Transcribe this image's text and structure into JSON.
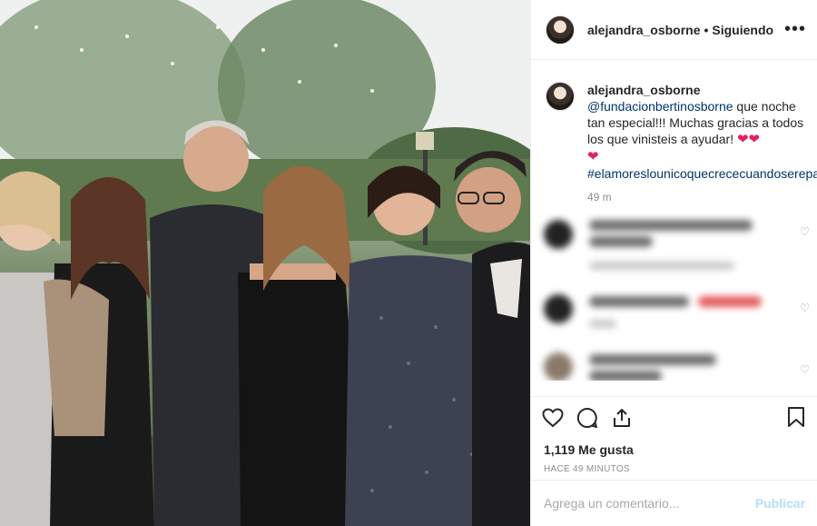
{
  "post": {
    "username": "alejandra_osborne",
    "separator": "•",
    "follow_status": "Siguiendo",
    "more": "•••",
    "caption": {
      "username": "alejandra_osborne",
      "mention": "@fundacionbertinosborne",
      "text_1": " que noche tan especial!!! Muchas gracias a todos los que vinisteis a ayudar! ",
      "hearts_1": "❤❤",
      "hearts_2": "❤",
      "hashtag": "#elamoreslounicoquecrececuandosereparte"
    },
    "caption_time": "49 m",
    "likes": "1,119 Me gusta",
    "posted_ago": "HACE 49 MINUTOS",
    "comment_placeholder": "Agrega un comentario...",
    "publish_label": "Publicar"
  },
  "colors": {
    "link": "#003569",
    "heart": "#e0245e",
    "publish": "#b2dffc",
    "muted": "#8e8e8e"
  },
  "icons": [
    "heart-icon",
    "comment-icon",
    "share-icon",
    "bookmark-icon",
    "more-icon"
  ]
}
